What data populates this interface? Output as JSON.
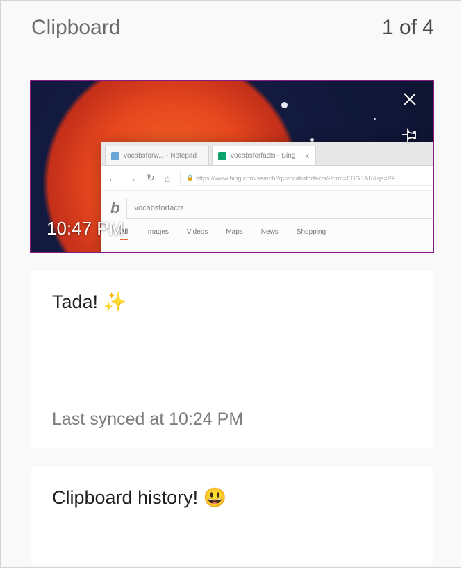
{
  "header": {
    "title": "Clipboard",
    "position": "1 of 4"
  },
  "items": [
    {
      "type": "image",
      "selected": true,
      "timestamp": "10:47 PM",
      "browser": {
        "tab1": "vocabsforw... - Notepad",
        "tab2": "vocabsforfacts - Bing",
        "url": "https://www.bing.com/search?q=vocabsforfacts&form=EDGEAR&qs=PF...",
        "query": "vocabsforfacts",
        "nav_tabs": [
          "All",
          "Images",
          "Videos",
          "Maps",
          "News",
          "Shopping"
        ]
      },
      "icons": {
        "close": "close-icon",
        "pin": "pin-icon"
      }
    },
    {
      "type": "text",
      "content": "Tada! ✨",
      "meta": "Last synced at 10:24 PM"
    },
    {
      "type": "text",
      "content": "Clipboard history! 😃"
    }
  ]
}
